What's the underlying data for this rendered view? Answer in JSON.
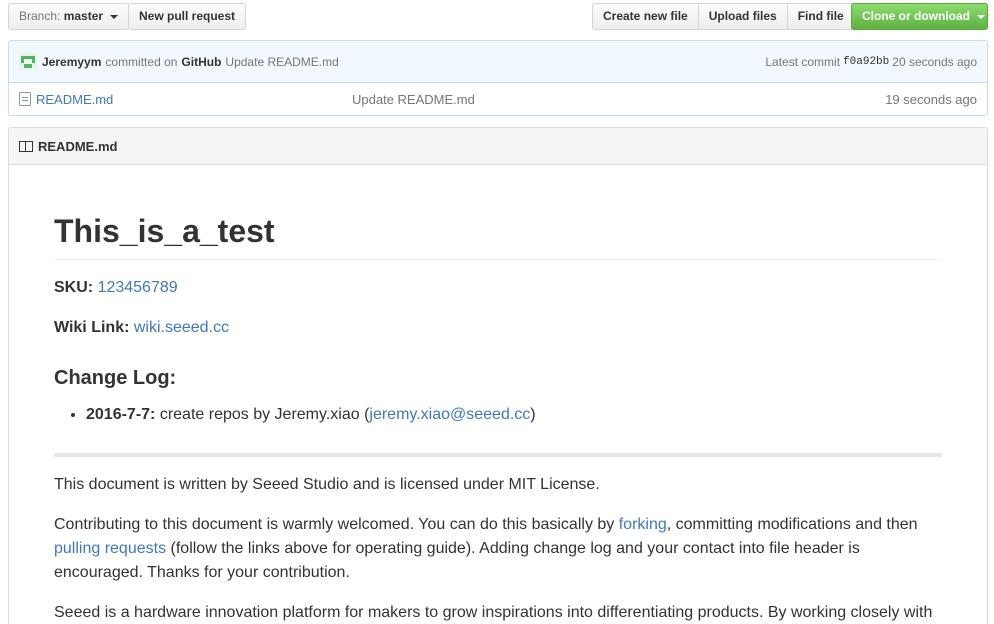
{
  "toolbar": {
    "branch_label": "Branch:",
    "branch_value": "master",
    "new_pr": "New pull request",
    "create_file": "Create new file",
    "upload_files": "Upload files",
    "find_file": "Find file",
    "clone_download": "Clone or download"
  },
  "commit": {
    "user": "Jeremyym",
    "committed_on": "committed on",
    "platform": "GitHub",
    "message": "Update README.md",
    "latest_label": "Latest commit",
    "sha": "f0a92bb",
    "age": "20 seconds ago"
  },
  "files": [
    {
      "name": "README.md",
      "message": "Update README.md",
      "age": "19 seconds ago"
    }
  ],
  "readme": {
    "header": "README.md",
    "title": "This_is_a_test",
    "sku_label": "SKU:",
    "sku_value": "123456789",
    "wiki_label": "Wiki Link:",
    "wiki_value": "wiki.seeed.cc",
    "changelog_heading": "Change Log:",
    "changelog_date": "2016-7-7:",
    "changelog_text": "create repos by Jeremy.xiao (",
    "changelog_email": "jeremy.xiao@seeed.cc",
    "changelog_close": ")",
    "license": "This document is written by Seeed Studio and is licensed under MIT License.",
    "contrib_1": "Contributing to this document is warmly welcomed. You can do this basically by ",
    "contrib_fork": "forking",
    "contrib_2": ", committing modifications and then ",
    "contrib_pull": "pulling requests",
    "contrib_3": " (follow the links above for operating guide). Adding change log and your contact into file header is encouraged. Thanks for your contribution.",
    "seeed_para": "Seeed is a hardware innovation platform for makers to grow inspirations into differentiating products. By working closely with"
  },
  "colors": {
    "link": "#4078c0",
    "green_button": "#60b044",
    "commit_bg": "#f1f8ff"
  }
}
